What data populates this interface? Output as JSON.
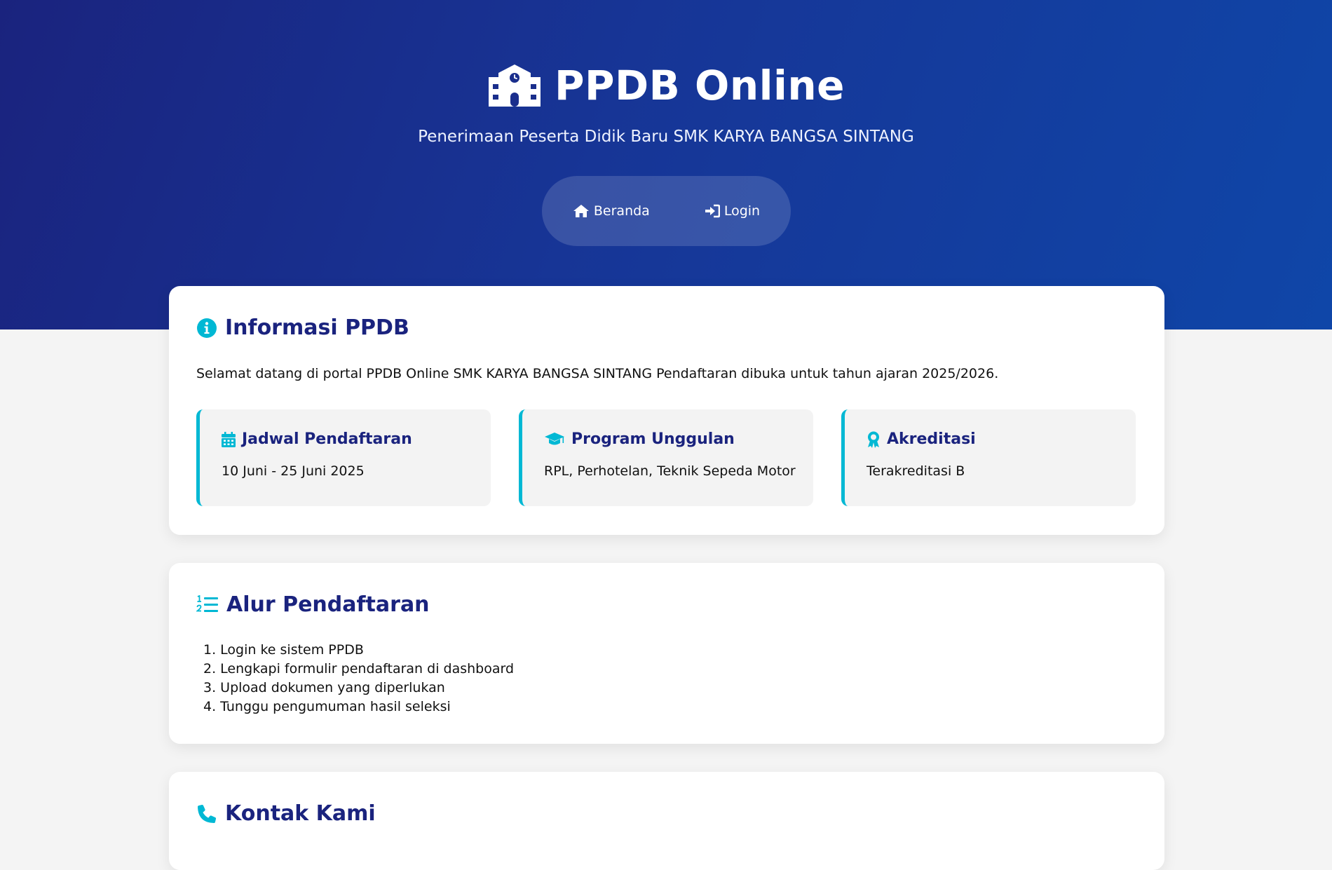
{
  "header": {
    "title": "PPDB Online",
    "subtitle": "Penerimaan Peserta Didik Baru SMK KARYA BANGSA SINTANG",
    "title_icon": "school-icon"
  },
  "nav": {
    "items": [
      {
        "label": "Beranda",
        "icon": "home-icon"
      },
      {
        "label": "Login",
        "icon": "sign-in-icon"
      }
    ]
  },
  "info": {
    "heading": "Informasi PPDB",
    "heading_icon": "info-circle-icon",
    "intro": "Selamat datang di portal PPDB Online SMK KARYA BANGSA SINTANG Pendaftaran dibuka untuk tahun ajaran 2025/2026.",
    "boxes": [
      {
        "title": "Jadwal Pendaftaran",
        "value": "10 Juni - 25 Juni 2025",
        "icon": "calendar-icon"
      },
      {
        "title": "Program Unggulan",
        "value": "RPL, Perhotelan, Teknik Sepeda Motor",
        "icon": "graduation-cap-icon"
      },
      {
        "title": "Akreditasi",
        "value": "Terakreditasi B",
        "icon": "award-icon"
      }
    ]
  },
  "flow": {
    "heading": "Alur Pendaftaran",
    "heading_icon": "ordered-list-icon",
    "steps": [
      "1. Login ke sistem PPDB",
      "2. Lengkapi formulir pendaftaran di dashboard",
      "3. Upload dokumen yang diperlukan",
      "4. Tunggu pengumuman hasil seleksi"
    ]
  },
  "contact": {
    "heading": "Kontak Kami",
    "heading_icon": "phone-icon"
  },
  "colors": {
    "header_gradient_start": "#1a237e",
    "header_gradient_end": "#0f46a8",
    "heading_text": "#1a237e",
    "accent": "#00b8d4",
    "page_background": "#f4f4f4"
  }
}
